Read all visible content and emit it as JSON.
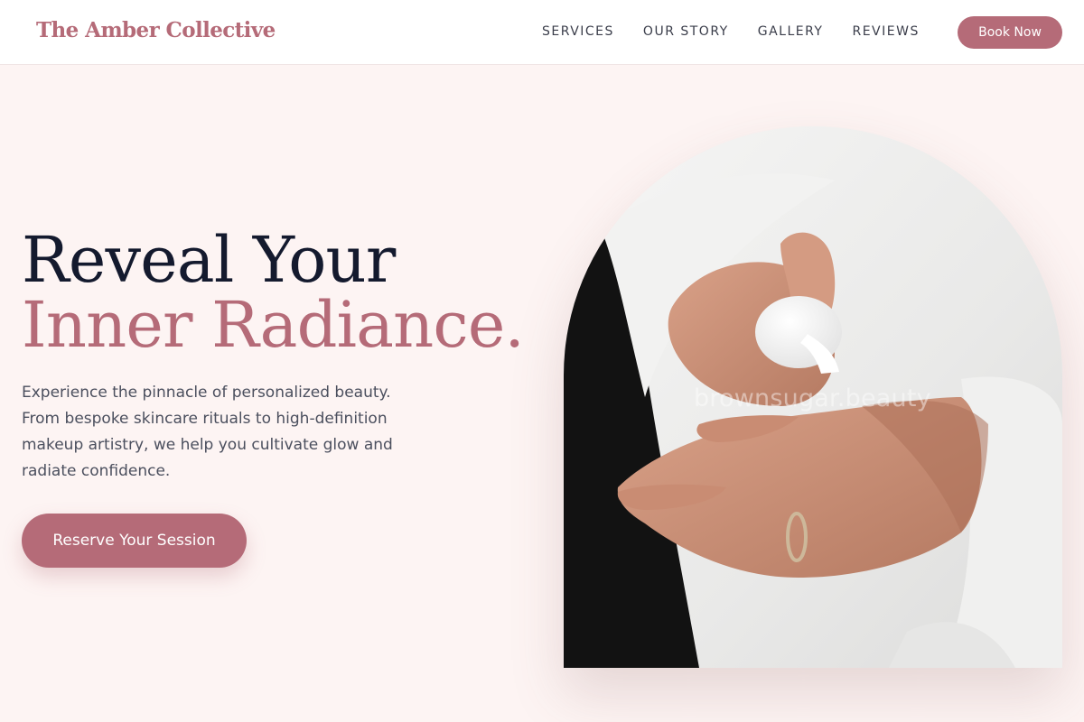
{
  "header": {
    "logo": "The Amber Collective",
    "nav": [
      "SERVICES",
      "OUR STORY",
      "GALLERY",
      "REVIEWS"
    ],
    "cta": "Book Now"
  },
  "hero": {
    "headline_line1": "Reveal Your",
    "headline_line2": "Inner Radiance.",
    "subtitle": "Experience the pinnacle of personalized beauty. From bespoke skincare rituals to high-definition makeup artistry, we help you cultivate glow and radiate confidence.",
    "cta": "Reserve Your Session",
    "image_watermark": "brownsugar.beauty"
  },
  "colors": {
    "accent": "#b56b78",
    "background": "#fdf4f3",
    "header_bg": "#ffffff",
    "heading_dark": "#141a2e",
    "body_text": "#4b4f5e"
  }
}
